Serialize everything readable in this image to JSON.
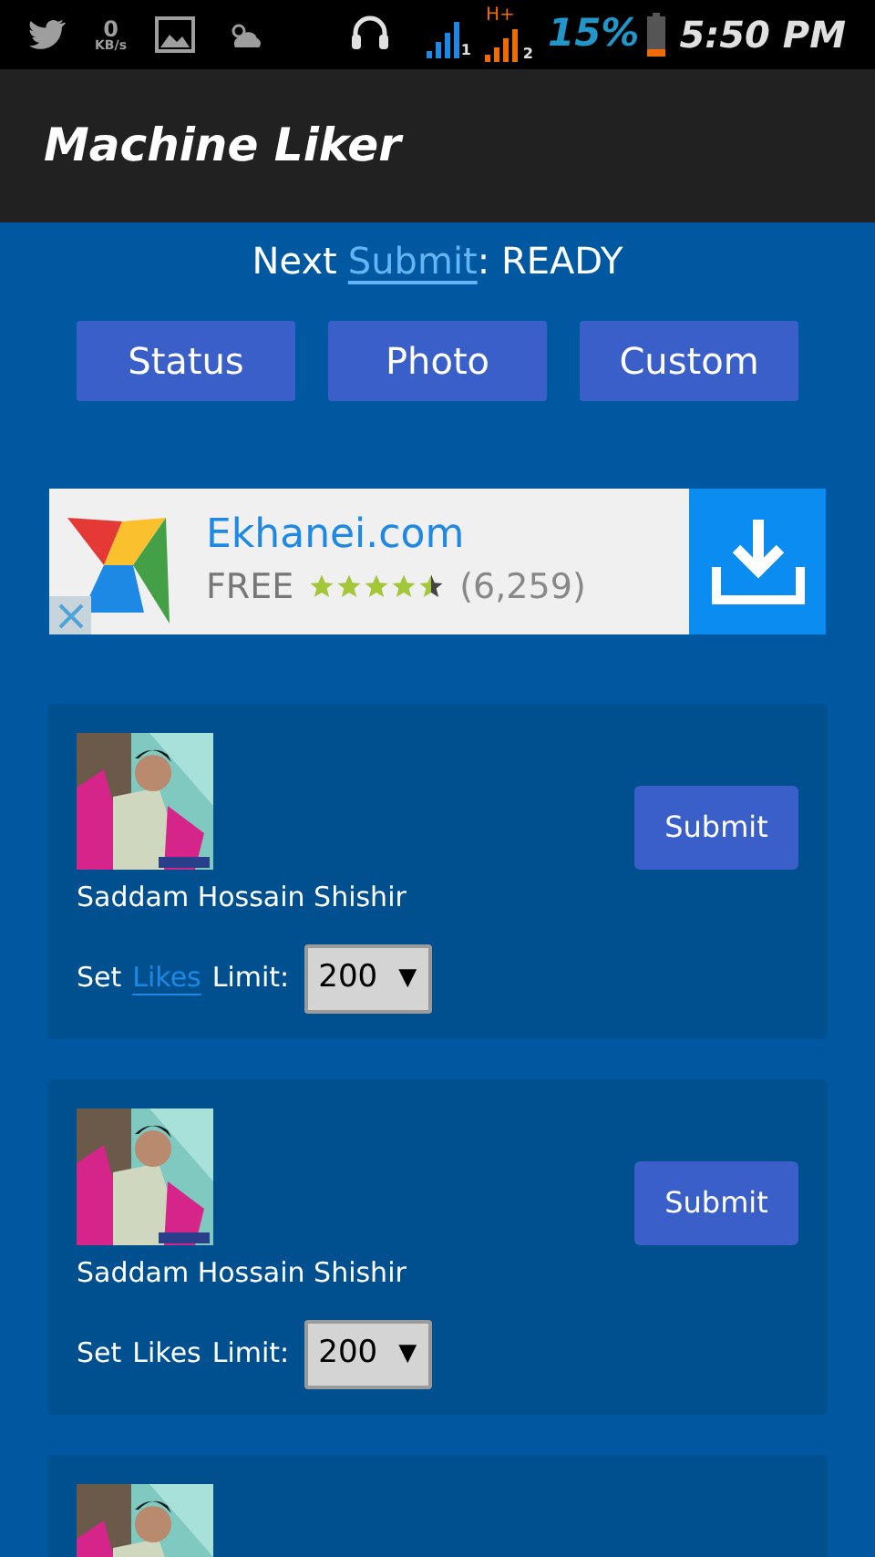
{
  "status_bar": {
    "net_speed": "0",
    "net_unit": "KB/s",
    "sim1": "1",
    "network_type": "H+",
    "sim2": "2",
    "battery": "15%",
    "time": "5:50 PM"
  },
  "app_bar": {
    "title": "Machine Liker"
  },
  "status_line": {
    "prefix": "Next",
    "link": "Submit",
    "separator": ":",
    "status": "READY"
  },
  "tabs": [
    {
      "label": "Status"
    },
    {
      "label": "Photo"
    },
    {
      "label": "Custom"
    }
  ],
  "ad": {
    "title": "Ekhanei.com",
    "price": "FREE",
    "stars": 4.5,
    "count": "(6,259)"
  },
  "cards": [
    {
      "kind": "full",
      "name": "Saddam Hossain Shishir",
      "button": "Submit",
      "limit_prefix": "Set",
      "limit_word": "Likes",
      "limit_suffix": "Limit:",
      "likes_link": true,
      "limit": "200",
      "arrow": "▼"
    },
    {
      "kind": "full",
      "name": "Saddam Hossain Shishir",
      "button": "Submit",
      "limit_prefix": "Set",
      "limit_word": "Likes",
      "limit_suffix": "Limit:",
      "likes_link": false,
      "limit": "200",
      "arrow": "▼"
    },
    {
      "kind": "partial"
    }
  ]
}
